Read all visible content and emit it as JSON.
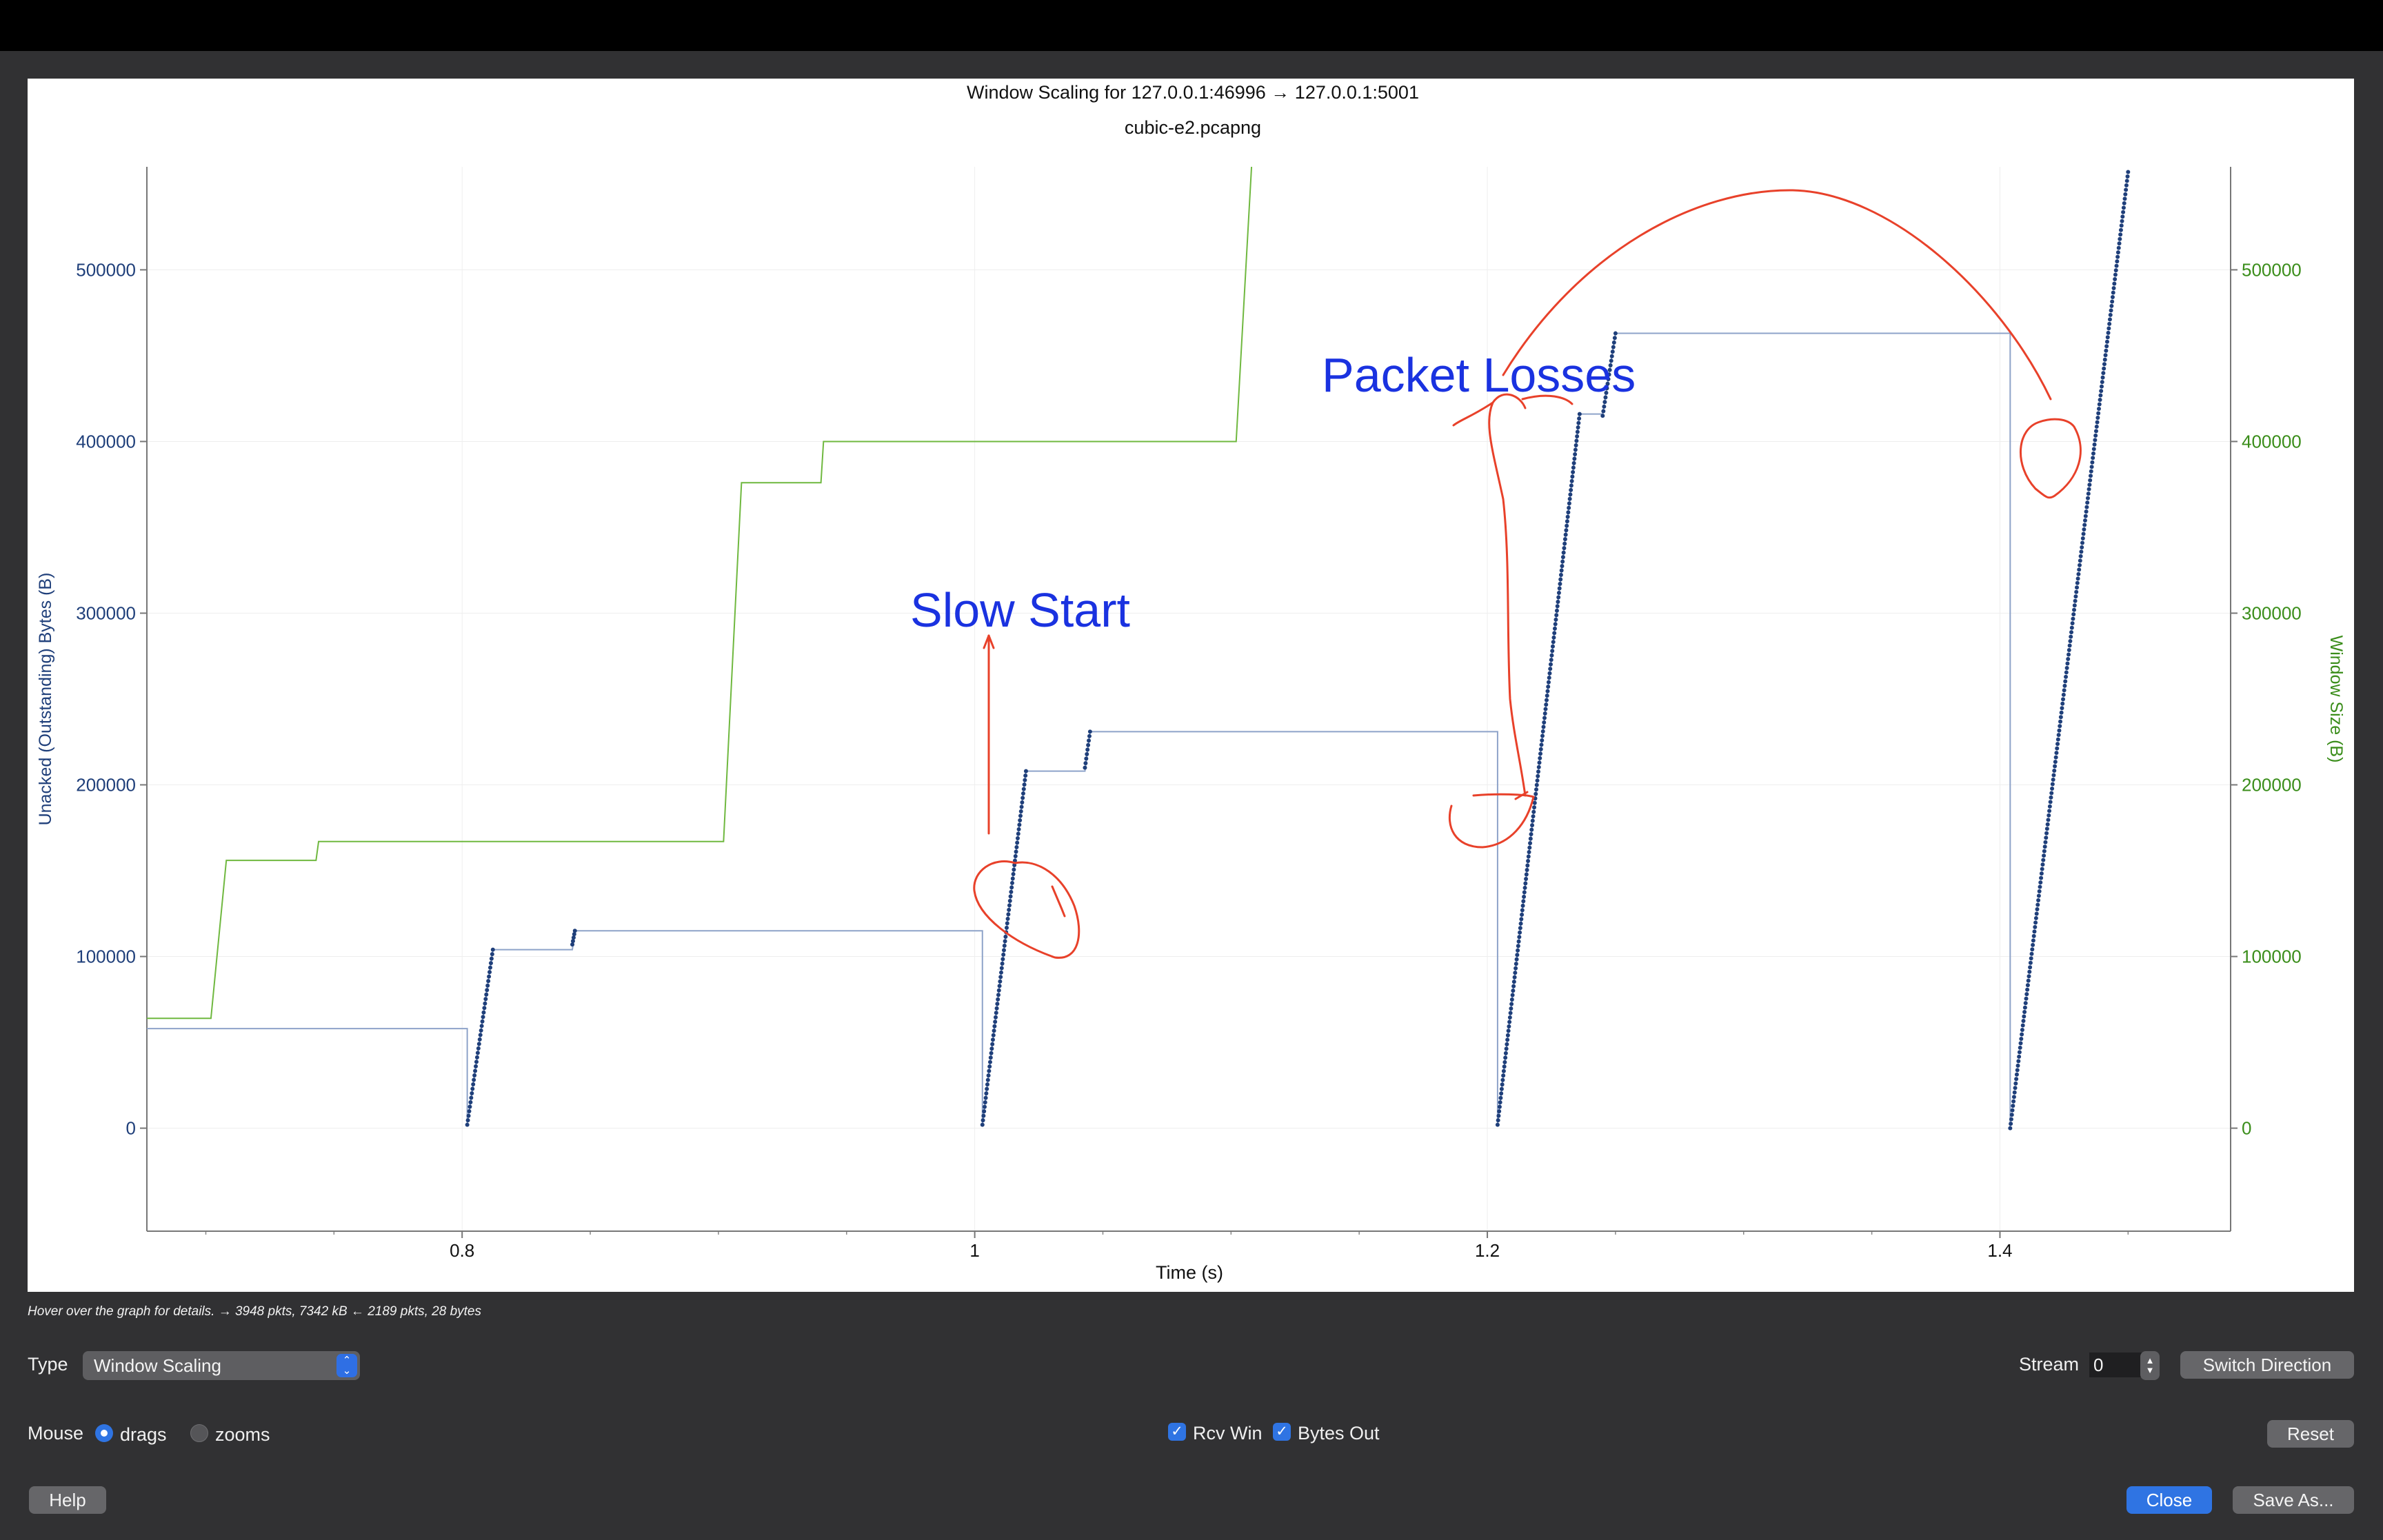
{
  "chart_data": {
    "type": "scatter",
    "title": "Window Scaling for 127.0.0.1:46996 → 127.0.0.1:5001",
    "subtitle": "cubic-e2.pcapng",
    "xlabel": "Time (s)",
    "ylabel_left": "Unacked (Outstanding) Bytes (B)",
    "ylabel_right": "Window Size (B)",
    "xlim": [
      0.677,
      1.49
    ],
    "ylim": [
      -60000,
      560000
    ],
    "x_ticks": [
      {
        "value": 0.8,
        "label": "0.8"
      },
      {
        "value": 1.0,
        "label": "1"
      },
      {
        "value": 1.2,
        "label": "1.2"
      },
      {
        "value": 1.4,
        "label": "1.4"
      }
    ],
    "y_ticks": [
      {
        "value": 0,
        "label": "0"
      },
      {
        "value": 100000,
        "label": "100000"
      },
      {
        "value": 200000,
        "label": "200000"
      },
      {
        "value": 300000,
        "label": "300000"
      },
      {
        "value": 400000,
        "label": "400000"
      },
      {
        "value": 500000,
        "label": "500000"
      }
    ],
    "grid": true,
    "colors": {
      "bytes_out": "#1f3f7a",
      "rcv_win": "#6fb83f",
      "axis_left": "#1f3f7a",
      "axis_right": "#3a8d1a",
      "annotation": "#e8412a",
      "annotation_text": "#1a32e0"
    },
    "series": [
      {
        "name": "Rcv Win",
        "style": "step",
        "points": [
          [
            0.677,
            64000
          ],
          [
            0.702,
            64000
          ],
          [
            0.708,
            156000
          ],
          [
            0.743,
            156000
          ],
          [
            0.744,
            167000
          ],
          [
            0.902,
            167000
          ],
          [
            0.909,
            376000
          ],
          [
            0.94,
            376000
          ],
          [
            0.941,
            400000
          ],
          [
            1.102,
            400000
          ],
          [
            1.108,
            560000
          ]
        ]
      },
      {
        "name": "Bytes Out",
        "segments": [
          {
            "x": [
              0.802,
              0.812
            ],
            "y": [
              2000,
              104000
            ]
          },
          {
            "x": [
              0.843,
              0.844
            ],
            "y": [
              107000,
              115000
            ]
          },
          {
            "x": [
              1.003,
              1.02
            ],
            "y": [
              2000,
              208000
            ]
          },
          {
            "x": [
              1.043,
              1.045
            ],
            "y": [
              210000,
              231000
            ]
          },
          {
            "x": [
              1.204,
              1.236
            ],
            "y": [
              2000,
              416000
            ]
          },
          {
            "x": [
              1.245,
              1.25
            ],
            "y": [
              415000,
              463000
            ]
          },
          {
            "x": [
              1.404,
              1.45
            ],
            "y": [
              0,
              557000
            ]
          }
        ]
      },
      {
        "name": "Receive window (step)",
        "style": "step",
        "points": [
          [
            0.677,
            58000
          ],
          [
            0.802,
            58000
          ],
          [
            0.802,
            2000
          ],
          [
            0.812,
            104000
          ],
          [
            0.843,
            104000
          ],
          [
            0.844,
            115000
          ],
          [
            1.003,
            115000
          ],
          [
            1.003,
            2000
          ],
          [
            1.02,
            208000
          ],
          [
            1.043,
            208000
          ],
          [
            1.045,
            231000
          ],
          [
            1.204,
            231000
          ],
          [
            1.204,
            2000
          ],
          [
            1.236,
            416000
          ],
          [
            1.245,
            416000
          ],
          [
            1.25,
            463000
          ],
          [
            1.404,
            463000
          ],
          [
            1.404,
            0
          ]
        ]
      }
    ],
    "annotations": [
      {
        "text": "Slow Start",
        "x": 1.015,
        "y": 295000
      },
      {
        "text": "Packet Losses",
        "x": 1.196,
        "y": 430000
      }
    ]
  },
  "status": "Hover over the graph for details. → 3948 pkts, 7342 kB ← 2189 pkts, 28 bytes",
  "controls": {
    "type_label": "Type",
    "type_value": "Window Scaling",
    "stream_label": "Stream",
    "stream_value": "0",
    "switch_direction": "Switch Direction",
    "mouse_label": "Mouse",
    "drags_label": "drags",
    "zooms_label": "zooms",
    "rcv_win_label": "Rcv Win",
    "bytes_out_label": "Bytes Out",
    "reset": "Reset",
    "help": "Help",
    "close": "Close",
    "save_as": "Save As..."
  }
}
